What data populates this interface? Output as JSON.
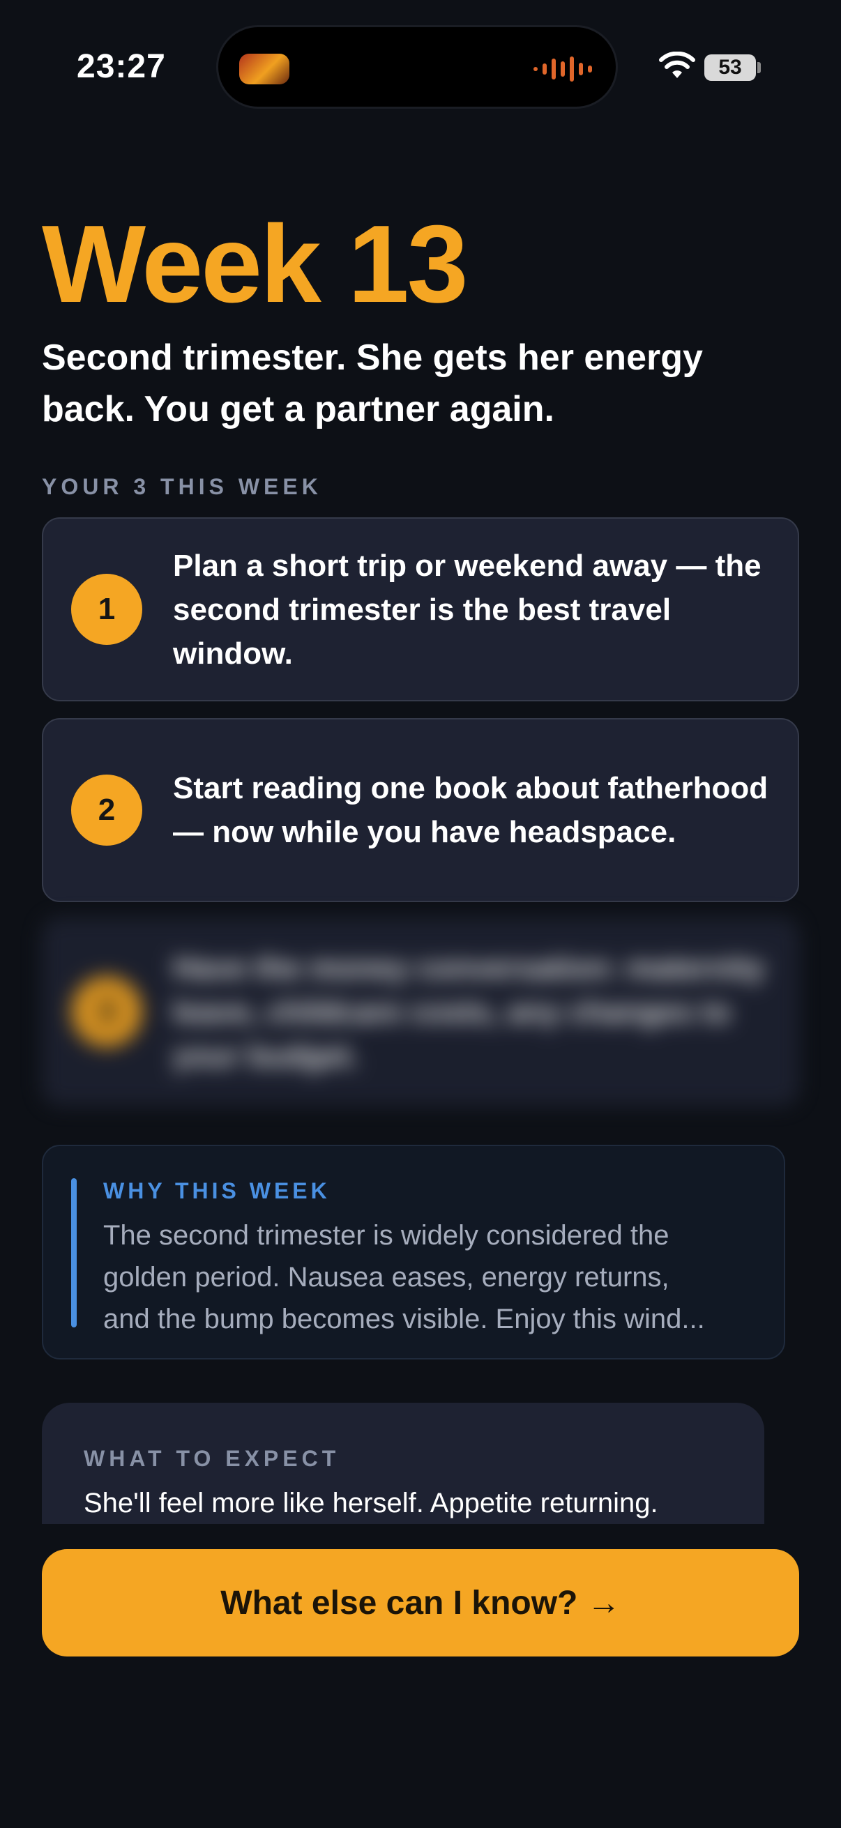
{
  "status_bar": {
    "time": "23:27",
    "battery": "53",
    "icons": [
      "now-playing-thumbnail-icon",
      "audio-waveform-icon",
      "wifi-icon",
      "battery-icon"
    ]
  },
  "header": {
    "title": "Week 13",
    "subtitle": "Second trimester. She gets her energy back. You get a partner again."
  },
  "tasks_section": {
    "label": "YOUR 3 THIS WEEK",
    "items": [
      {
        "number": "1",
        "text": "Plan a short trip or weekend away — the second trimester is the best travel window."
      },
      {
        "number": "2",
        "text": "Start reading one book about fatherhood — now while you have headspace."
      },
      {
        "number": "3",
        "text": "Have the money conversation: maternity leave, childcare costs, any changes to your budget."
      }
    ]
  },
  "why_card": {
    "label": "WHY THIS WEEK",
    "lines": [
      "The second trimester is widely considered the",
      "golden period. Nausea eases, energy returns,",
      "and the bump becomes visible. Enjoy this wind..."
    ]
  },
  "expect_card": {
    "label": "WHAT TO EXPECT",
    "text": "She'll feel more like herself. Appetite returning."
  },
  "cta": {
    "label": "What else can I know? →"
  },
  "colors": {
    "background": "#0d1016",
    "accent": "#f5a623",
    "card": "#1e2232",
    "info_blue": "#4a90e2",
    "muted_text": "#8891a6"
  }
}
